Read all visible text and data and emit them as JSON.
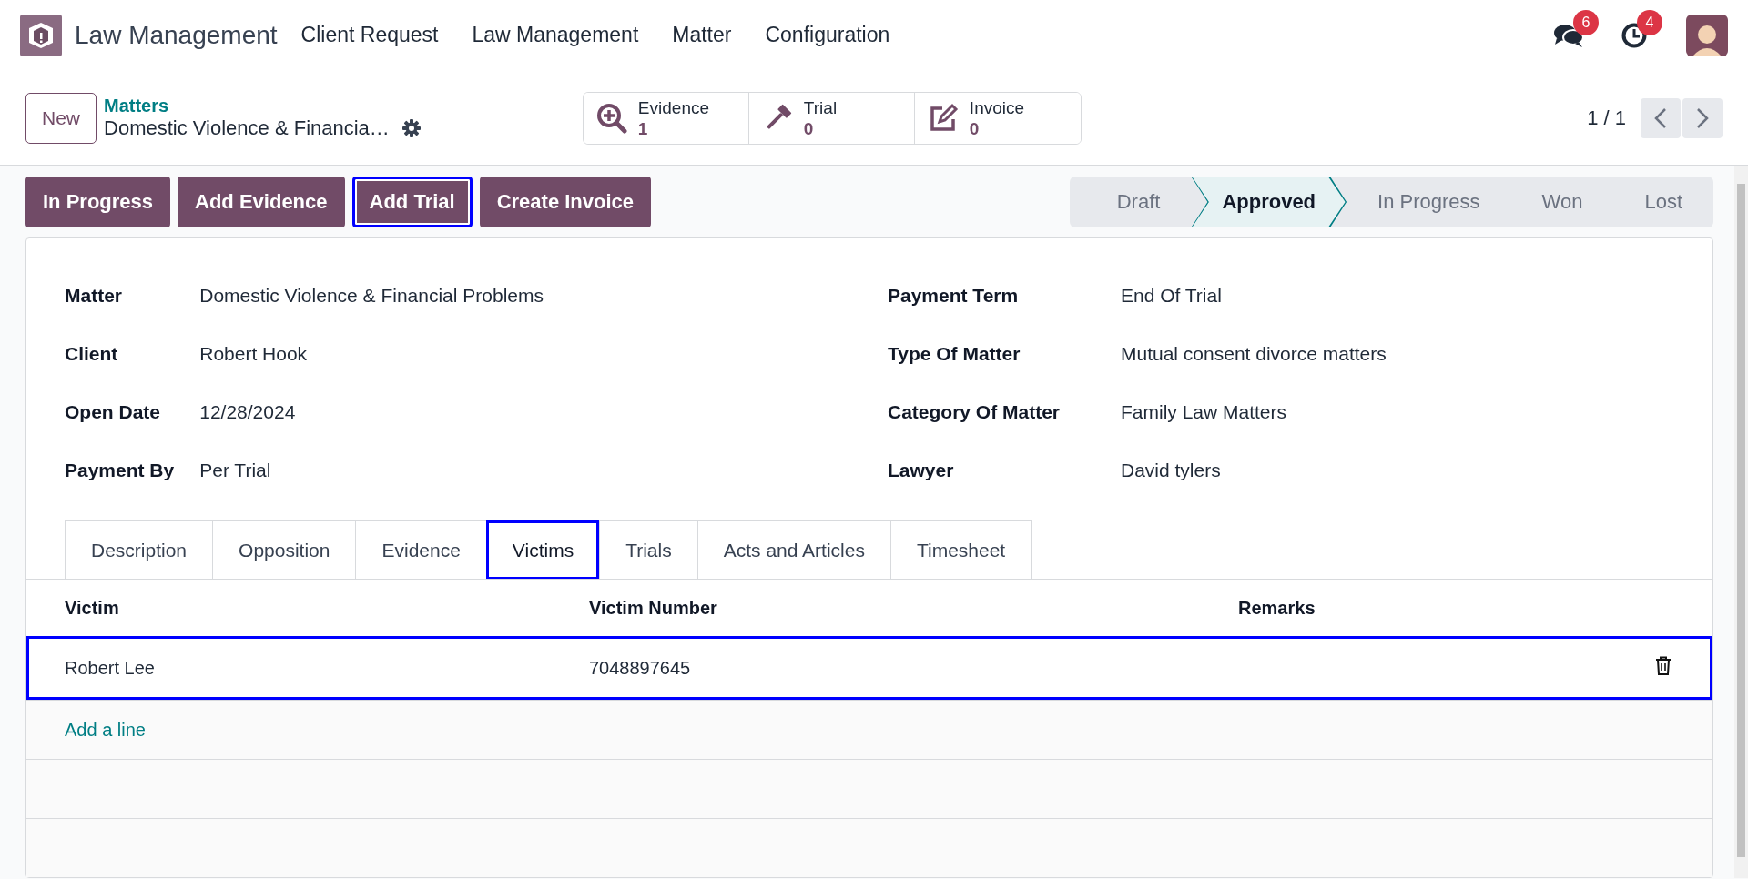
{
  "navbar": {
    "app_name": "Law Management",
    "menu": [
      "Client Request",
      "Law Management",
      "Matter",
      "Configuration"
    ],
    "messages_badge": "6",
    "activities_badge": "4"
  },
  "control_panel": {
    "new_button": "New",
    "breadcrumb": "Matters",
    "record_title": "Domestic Violence & Financia…",
    "smart_buttons": [
      {
        "kind": "evidence",
        "label": "Evidence",
        "count": "1"
      },
      {
        "kind": "trial",
        "label": "Trial",
        "count": "0"
      },
      {
        "kind": "invoice",
        "label": "Invoice",
        "count": "0"
      }
    ],
    "pager": "1 / 1"
  },
  "action_buttons": [
    {
      "label": "In Progress",
      "highlighted": false
    },
    {
      "label": "Add Evidence",
      "highlighted": false
    },
    {
      "label": "Add Trial",
      "highlighted": true
    },
    {
      "label": "Create Invoice",
      "highlighted": false
    }
  ],
  "status_bar": [
    {
      "label": "Draft",
      "selected": false
    },
    {
      "label": "Approved",
      "selected": true
    },
    {
      "label": "In Progress",
      "selected": false
    },
    {
      "label": "Won",
      "selected": false
    },
    {
      "label": "Lost",
      "selected": false
    }
  ],
  "fields_left": [
    {
      "label": "Matter",
      "value": "Domestic Violence & Financial Problems"
    },
    {
      "label": "Client",
      "value": "Robert Hook"
    },
    {
      "label": "Open Date",
      "value": "12/28/2024"
    },
    {
      "label": "Payment By",
      "value": "Per Trial"
    }
  ],
  "fields_right": [
    {
      "label": "Payment Term",
      "value": "End Of Trial"
    },
    {
      "label": "Type Of Matter",
      "value": "Mutual consent divorce matters"
    },
    {
      "label": "Category Of Matter",
      "value": "Family Law Matters"
    },
    {
      "label": "Lawyer",
      "value": "David tylers"
    }
  ],
  "tabs": [
    {
      "label": "Description",
      "selected": false,
      "highlighted": false
    },
    {
      "label": "Opposition",
      "selected": false,
      "highlighted": false
    },
    {
      "label": "Evidence",
      "selected": false,
      "highlighted": false
    },
    {
      "label": "Victims",
      "selected": true,
      "highlighted": true
    },
    {
      "label": "Trials",
      "selected": false,
      "highlighted": false
    },
    {
      "label": "Acts and Articles",
      "selected": false,
      "highlighted": false
    },
    {
      "label": "Timesheet",
      "selected": false,
      "highlighted": false
    }
  ],
  "table": {
    "columns": [
      "Victim",
      "Victim Number",
      "Remarks"
    ],
    "rows": [
      {
        "victim": "Robert Lee",
        "victim_number": "7048897645",
        "highlighted": true
      }
    ],
    "add_line": "Add a line"
  }
}
